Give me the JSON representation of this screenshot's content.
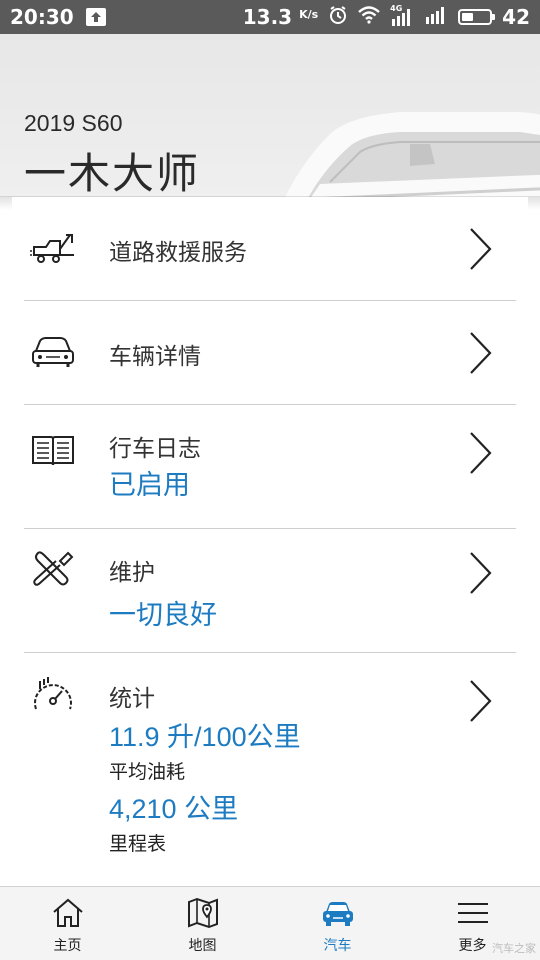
{
  "status_bar": {
    "time": "20:30",
    "speed": "13.3",
    "speed_unit": "K/s",
    "network": "4G",
    "battery": "42",
    "battery_level": 0.42
  },
  "header": {
    "model_year": "2019 S60",
    "car_name": "一木大师"
  },
  "menu": {
    "roadside": {
      "title": "道路救援服务",
      "icon": "tow-truck-icon"
    },
    "vehicle": {
      "title": "车辆详情",
      "icon": "car-front-icon"
    },
    "logbook": {
      "title": "行车日志",
      "value": "已启用",
      "icon": "book-icon"
    },
    "maintenance": {
      "title": "维护",
      "value": "一切良好",
      "icon": "wrench-screwdriver-icon"
    },
    "stats": {
      "title": "统计",
      "fuel_value": "11.9 升/100公里",
      "fuel_caption": "平均油耗",
      "odometer_value": "4,210 公里",
      "odometer_caption": "里程表",
      "icon": "gauge-icon"
    }
  },
  "bottom_nav": {
    "tabs": [
      {
        "label": "主页",
        "icon": "home-icon"
      },
      {
        "label": "地图",
        "icon": "map-icon"
      },
      {
        "label": "汽车",
        "icon": "car-icon",
        "active": true
      },
      {
        "label": "更多",
        "icon": "menu-icon"
      }
    ]
  },
  "watermark": "汽车之家",
  "colors": {
    "accent": "#1d7bc2",
    "status_bar": "#5a5a5a",
    "header_bg": "#e7e7e7"
  }
}
